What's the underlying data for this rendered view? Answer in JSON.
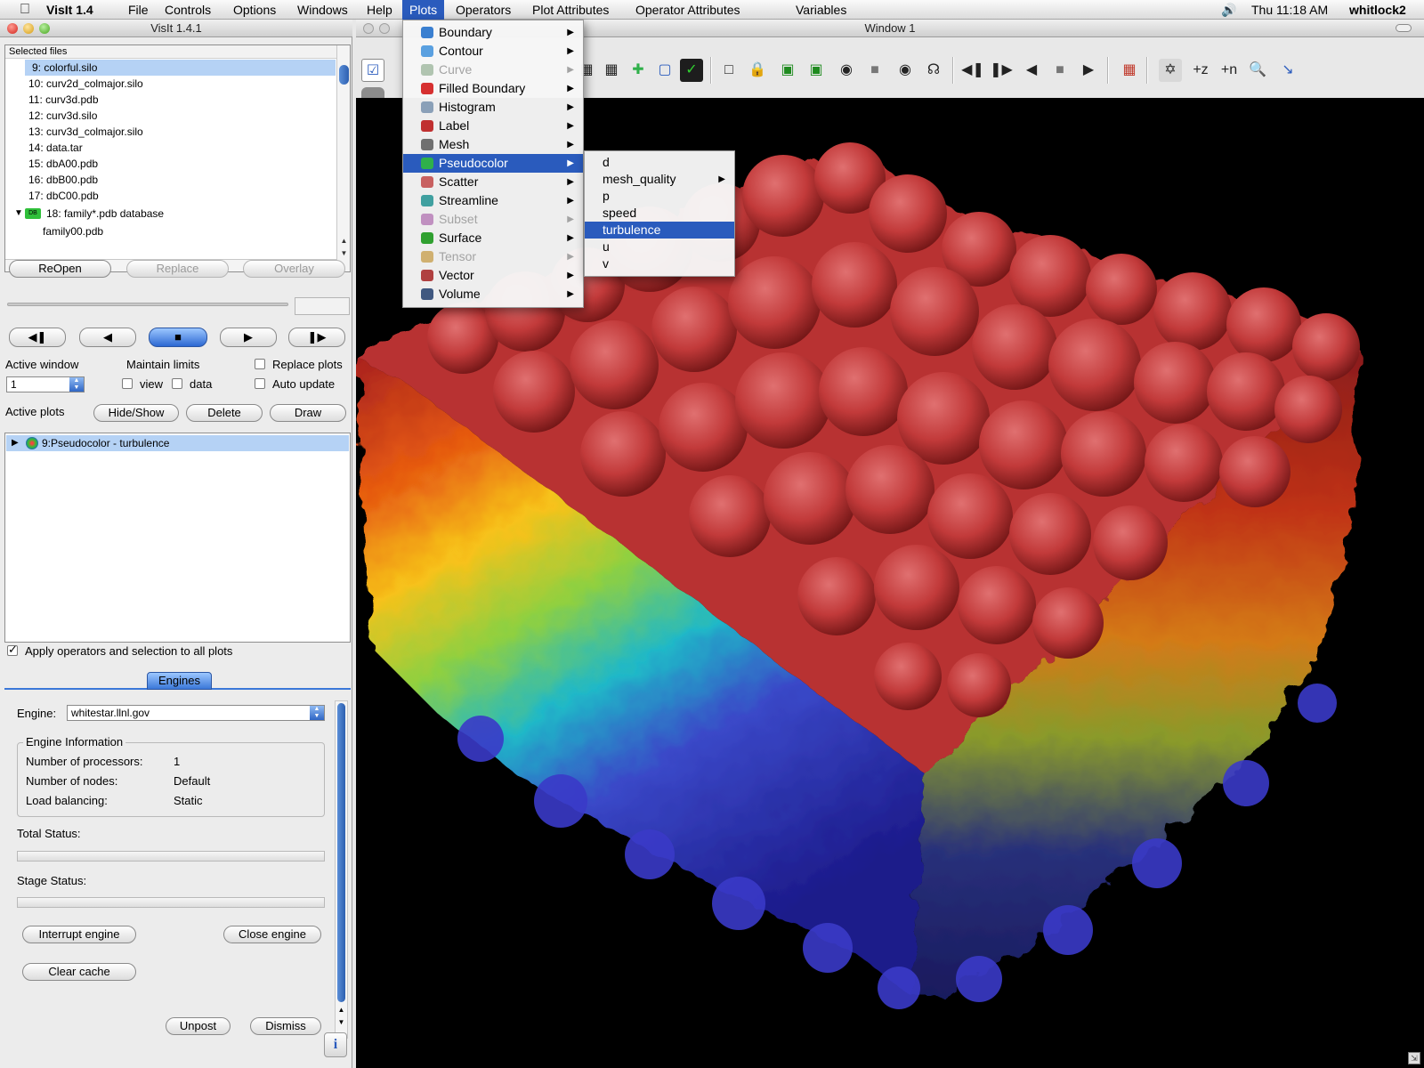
{
  "menubar": {
    "app": "VisIt 1.4",
    "items": [
      "File",
      "Controls",
      "Options",
      "Windows",
      "Help",
      "Plots",
      "Operators",
      "Plot Attributes",
      "Operator Attributes",
      "Variables"
    ],
    "clock": "Thu 11:18 AM",
    "user": "whitlock2"
  },
  "main_window": {
    "title": "VisIt 1.4.1",
    "files": {
      "header": "Selected files",
      "items": [
        "9: colorful.silo",
        "10: curv2d_colmajor.silo",
        "11: curv3d.pdb",
        "12: curv3d.silo",
        "13: curv3d_colmajor.silo",
        "14: data.tar",
        "15: dbA00.pdb",
        "16: dbB00.pdb",
        "17: dbC00.pdb",
        "18: family*.pdb database",
        "family00.pdb"
      ]
    },
    "file_buttons": {
      "reopen": "ReOpen",
      "replace": "Replace",
      "overlay": "Overlay"
    },
    "active_window": {
      "label": "Active window",
      "value": "1"
    },
    "maintain_limits": {
      "label": "Maintain limits",
      "view": "view",
      "data": "data"
    },
    "options": {
      "replace_plots": "Replace plots",
      "auto_update": "Auto update"
    },
    "active_plots": {
      "label": "Active plots",
      "hide_show": "Hide/Show",
      "delete": "Delete",
      "draw": "Draw",
      "items": [
        "9:Pseudocolor - turbulence"
      ]
    },
    "apply_operators": "Apply operators and selection to all plots",
    "engines": {
      "tab": "Engines",
      "engine_label": "Engine:",
      "engine_value": "whitestar.llnl.gov",
      "info_title": "Engine Information",
      "rows": [
        {
          "key": "Number of processors:",
          "value": "1"
        },
        {
          "key": "Number of nodes:",
          "value": "Default"
        },
        {
          "key": "Load balancing:",
          "value": "Static"
        }
      ],
      "total_status": "Total Status:",
      "stage_status": "Stage Status:",
      "interrupt": "Interrupt engine",
      "close": "Close engine",
      "clear_cache": "Clear cache",
      "unpost": "Unpost",
      "dismiss": "Dismiss"
    }
  },
  "vis_window": {
    "title": "Window 1"
  },
  "plots_menu": {
    "items": [
      {
        "label": "Boundary",
        "enabled": true,
        "color": "#3a7fd0"
      },
      {
        "label": "Contour",
        "enabled": true,
        "color": "#5aa0e0"
      },
      {
        "label": "Curve",
        "enabled": false,
        "color": "#b0c4b0"
      },
      {
        "label": "Filled Boundary",
        "enabled": true,
        "color": "#d63030"
      },
      {
        "label": "Histogram",
        "enabled": true,
        "color": "#8aa0b8"
      },
      {
        "label": "Label",
        "enabled": true,
        "color": "#c03030"
      },
      {
        "label": "Mesh",
        "enabled": true,
        "color": "#707070"
      },
      {
        "label": "Pseudocolor",
        "enabled": true,
        "color": "#2fb04a"
      },
      {
        "label": "Scatter",
        "enabled": true,
        "color": "#c86060"
      },
      {
        "label": "Streamline",
        "enabled": true,
        "color": "#40a0a0"
      },
      {
        "label": "Subset",
        "enabled": false,
        "color": "#c090c0"
      },
      {
        "label": "Surface",
        "enabled": true,
        "color": "#30a030"
      },
      {
        "label": "Tensor",
        "enabled": false,
        "color": "#d0b070"
      },
      {
        "label": "Vector",
        "enabled": true,
        "color": "#b04040"
      },
      {
        "label": "Volume",
        "enabled": true,
        "color": "#405880"
      }
    ],
    "highlighted": "Pseudocolor"
  },
  "pseudocolor_submenu": {
    "items": [
      "d",
      "mesh_quality",
      "p",
      "speed",
      "turbulence",
      "u",
      "v"
    ],
    "highlighted": "turbulence"
  },
  "colors": {
    "accent": "#2a5bbd",
    "selection": "#b5d2f5",
    "canvas": "#000000"
  }
}
